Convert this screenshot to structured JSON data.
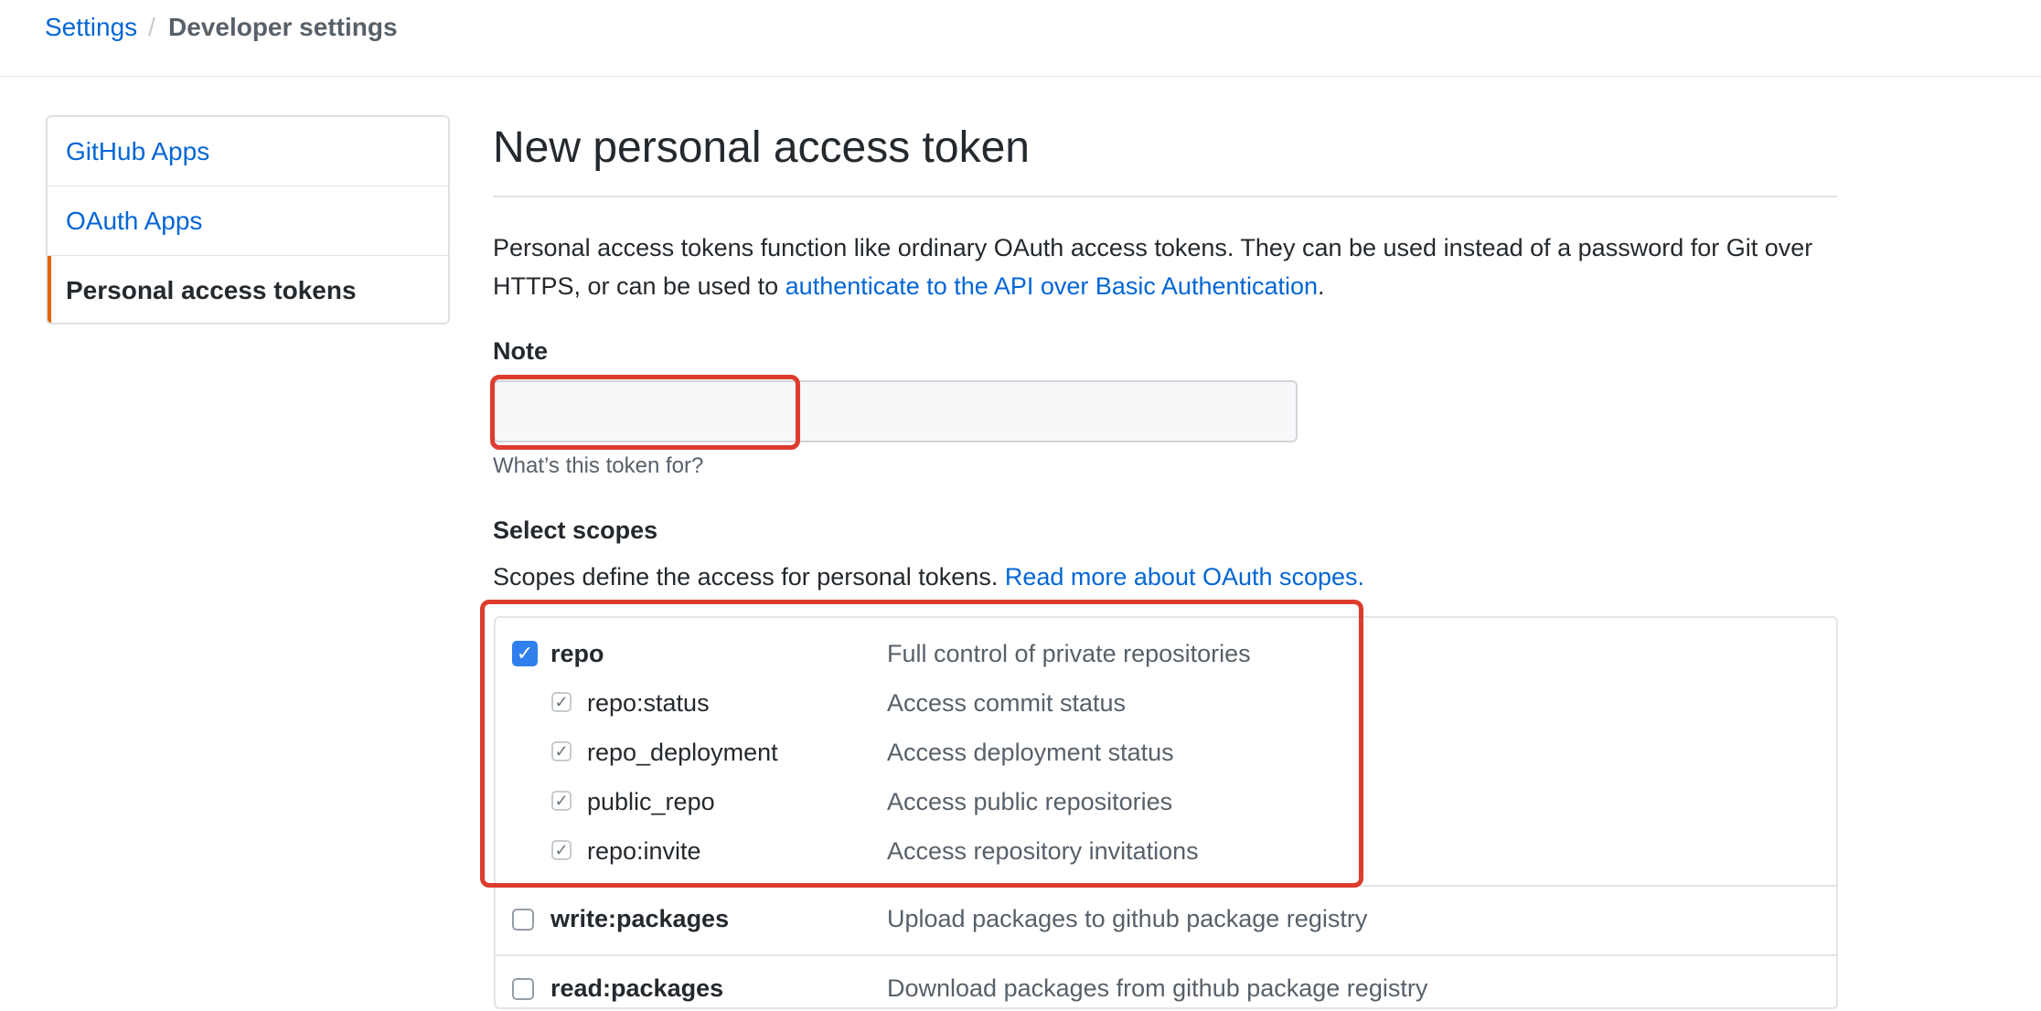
{
  "breadcrumb": {
    "parent": "Settings",
    "separator": "/",
    "current": "Developer settings"
  },
  "sidebar": {
    "items": [
      {
        "label": "GitHub Apps",
        "active": false
      },
      {
        "label": "OAuth Apps",
        "active": false
      },
      {
        "label": "Personal access tokens",
        "active": true
      }
    ]
  },
  "main": {
    "title": "New personal access token",
    "intro": {
      "text_before": "Personal access tokens function like ordinary OAuth access tokens. They can be used instead of a password for Git over HTTPS, or can be used to ",
      "link": "authenticate to the API over Basic Authentication",
      "text_after": "."
    },
    "note": {
      "label": "Note",
      "value": "",
      "placeholder": "",
      "hint": "What’s this token for?"
    },
    "scopes": {
      "label": "Select scopes",
      "description": "Scopes define the access for personal tokens. ",
      "description_link": "Read more about OAuth scopes.",
      "items": [
        {
          "name": "repo",
          "description": "Full control of private repositories",
          "checked": true
        },
        {
          "name": "repo:status",
          "description": "Access commit status",
          "checked": true
        },
        {
          "name": "repo_deployment",
          "description": "Access deployment status",
          "checked": true
        },
        {
          "name": "public_repo",
          "description": "Access public repositories",
          "checked": true
        },
        {
          "name": "repo:invite",
          "description": "Access repository invitations",
          "checked": true
        },
        {
          "name": "write:packages",
          "description": "Upload packages to github package registry",
          "checked": false
        },
        {
          "name": "read:packages",
          "description": "Download packages from github package registry",
          "checked": false
        }
      ]
    }
  },
  "colors": {
    "link": "#0366d6",
    "accent_active": "#e36209",
    "checkbox_checked": "#2f80ed",
    "annotation": "#dc3c2e"
  },
  "icons": {
    "checkbox_checked": "check-icon"
  }
}
